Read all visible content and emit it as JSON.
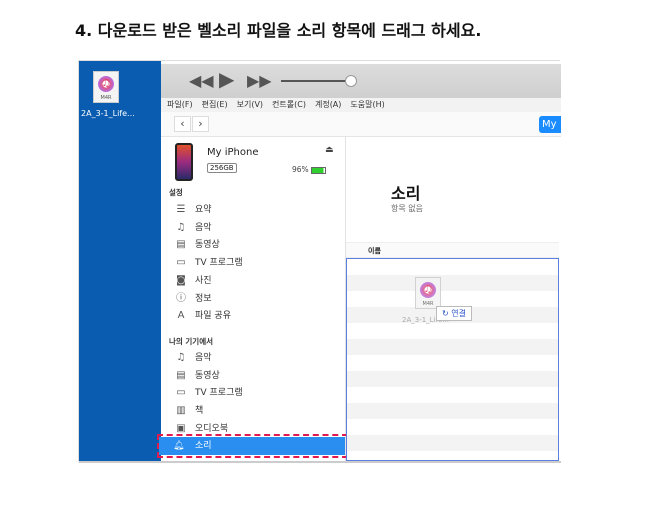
{
  "heading": "4. 다운로드 받은 벨소리 파일을 소리 항목에 드래그 하세요.",
  "desktop": {
    "file_type": "M4R",
    "file_name": "2A_3-1_Life..."
  },
  "menu": [
    "파일(F)",
    "편집(E)",
    "보기(V)",
    "컨트롤(C)",
    "계정(A)",
    "도움말(H)"
  ],
  "nav": {
    "back": "‹",
    "forward": "›",
    "device_button": "My"
  },
  "device": {
    "name": "My iPhone",
    "capacity": "256GB",
    "battery": "96%"
  },
  "settings": {
    "title": "설정",
    "items": [
      {
        "icon": "list-icon",
        "g": "☰",
        "label": "요약"
      },
      {
        "icon": "music-icon",
        "g": "♫",
        "label": "음악"
      },
      {
        "icon": "film-icon",
        "g": "▤",
        "label": "동영상"
      },
      {
        "icon": "tv-icon",
        "g": "▭",
        "label": "TV 프로그램"
      },
      {
        "icon": "camera-icon",
        "g": "◙",
        "label": "사진"
      },
      {
        "icon": "info-icon",
        "g": "ⓘ",
        "label": "정보"
      },
      {
        "icon": "apps-icon",
        "g": "A",
        "label": "파일 공유"
      }
    ]
  },
  "on_device": {
    "title": "나의 기기에서",
    "items": [
      {
        "icon": "music-icon",
        "g": "♫",
        "label": "음악"
      },
      {
        "icon": "film-icon",
        "g": "▤",
        "label": "동영상"
      },
      {
        "icon": "tv-icon",
        "g": "▭",
        "label": "TV 프로그램"
      },
      {
        "icon": "book-icon",
        "g": "▥",
        "label": "책"
      },
      {
        "icon": "audiobook-icon",
        "g": "▣",
        "label": "오디오북"
      }
    ],
    "selected": {
      "icon": "bell-icon",
      "g": "♫",
      "label": "소리"
    }
  },
  "content": {
    "title": "소리",
    "subtitle": "항목 없음",
    "column": "이름",
    "drag_file_type": "M4R",
    "drag_file_name": "2A_3-1_Life...",
    "drop_label": "↻ 연결"
  },
  "colors": {
    "accent": "#2a8ef0",
    "highlight": "#e0194f",
    "desktop": "#0a5cb0"
  }
}
